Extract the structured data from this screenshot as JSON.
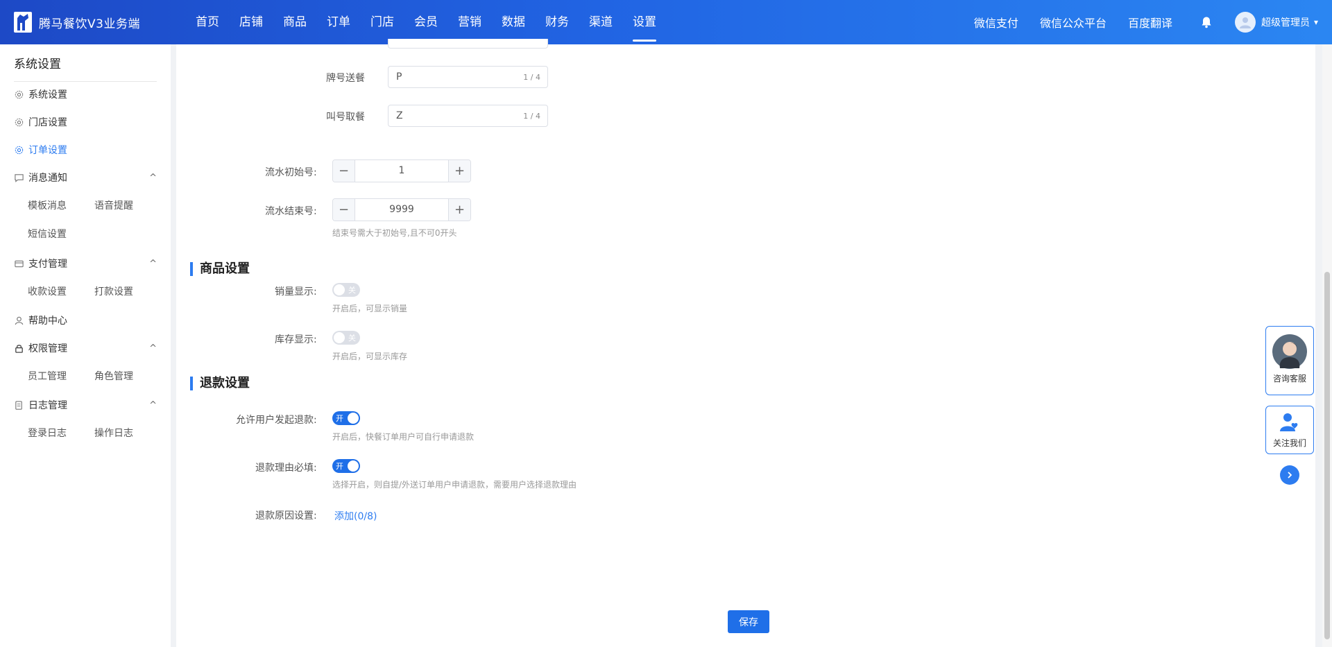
{
  "header": {
    "brand_title": "腾马餐饮V3业务端",
    "nav": [
      "首页",
      "店铺",
      "商品",
      "订单",
      "门店",
      "会员",
      "营销",
      "数据",
      "财务",
      "渠道",
      "设置"
    ],
    "active_nav": "设置",
    "links": [
      "微信支付",
      "微信公众平台",
      "百度翻译"
    ],
    "user_name": "超级管理员"
  },
  "sidebar": {
    "title": "系统设置",
    "items": {
      "system": "系统设置",
      "store": "门店设置",
      "order": "订单设置",
      "message": "消息通知",
      "template_msg": "模板消息",
      "voice": "语音提醒",
      "sms": "短信设置",
      "payment": "支付管理",
      "collect": "收款设置",
      "payout": "打款设置",
      "help": "帮助中心",
      "permission": "权限管理",
      "staff": "员工管理",
      "role": "角色管理",
      "log": "日志管理",
      "login_log": "登录日志",
      "op_log": "操作日志"
    }
  },
  "form": {
    "plate_label": "牌号送餐",
    "plate_value": "P",
    "plate_count": "1 / 4",
    "call_label": "叫号取餐",
    "call_value": "Z",
    "call_count": "1 / 4",
    "serial_start_label": "流水初始号:",
    "serial_start_value": "1",
    "serial_end_label": "流水结束号:",
    "serial_end_value": "9999",
    "serial_hint": "结束号需大于初始号,且不可0开头"
  },
  "goods_section": {
    "title": "商品设置",
    "sales_label": "销量显示:",
    "sales_switch": "关",
    "sales_hint": "开启后，可显示销量",
    "stock_label": "库存显示:",
    "stock_switch": "关",
    "stock_hint": "开启后，可显示库存"
  },
  "refund_section": {
    "title": "退款设置",
    "allow_label": "允许用户发起退款:",
    "allow_switch": "开",
    "allow_hint": "开启后，快餐订单用户可自行申请退款",
    "reason_required_label": "退款理由必填:",
    "reason_required_switch": "开",
    "reason_required_hint": "选择开启，则自提/外送订单用户申请退款，需要用户选择退款理由",
    "reason_setting_label": "退款原因设置:",
    "add_link": "添加(0/8)"
  },
  "save_label": "保存",
  "float": {
    "consult": "咨询客服",
    "follow": "关注我们"
  },
  "colors": {
    "accent": "#2d7cf0",
    "header_start": "#1d49c6",
    "header_end": "#2b86f2"
  }
}
